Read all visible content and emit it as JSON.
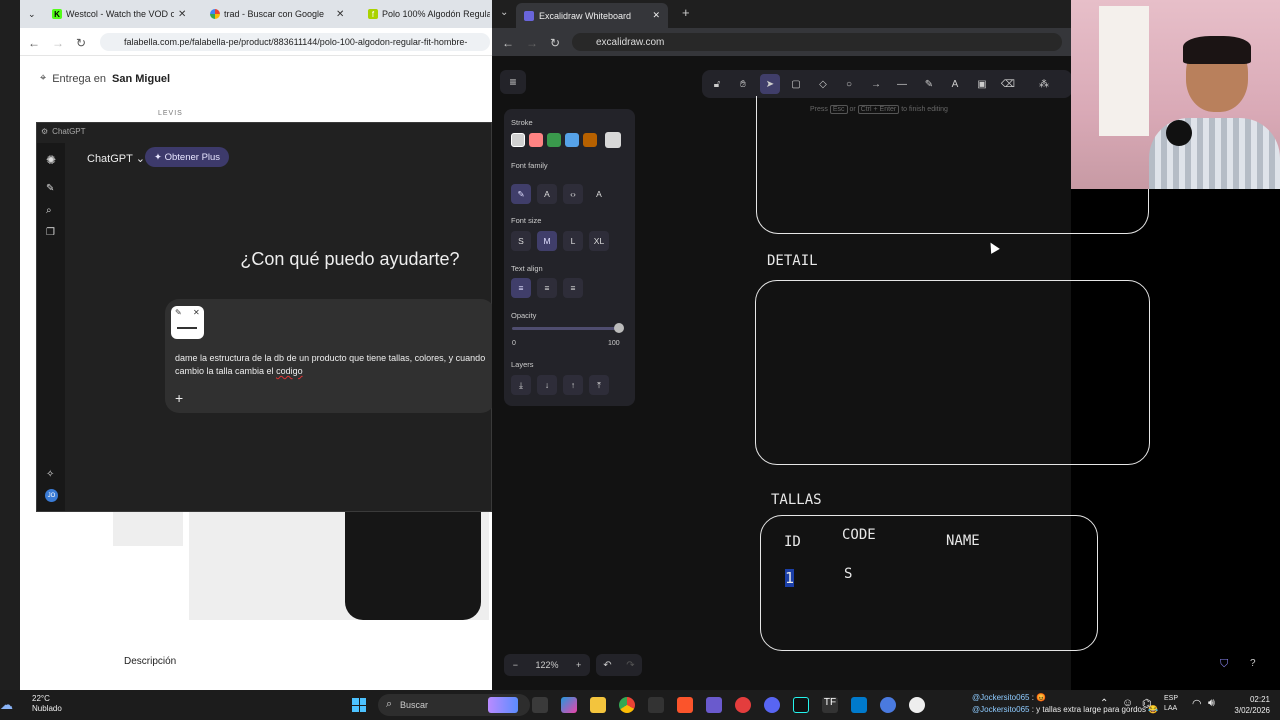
{
  "left_browser": {
    "tabs": [
      {
        "title": "Westcol - Watch the VOD on K",
        "icon": "kick-icon"
      },
      {
        "title": "trad - Buscar con Google",
        "icon": "google-icon"
      },
      {
        "title": "Polo 100% Algodón Regular Fi",
        "icon": "falabella-icon"
      }
    ],
    "url": "falabella.com.pe/falabella-pe/product/883611144/polo-100-algodon-regular-fit-hombre-",
    "delivery_prefix": "Entrega en",
    "delivery_location": "San Miguel",
    "brand": "LEVIS",
    "description_label": "Descripción"
  },
  "chatgpt": {
    "window_title": "ChatGPT",
    "model": "ChatGPT",
    "upgrade_label": "✦ Obtener Plus",
    "heading": "¿Con qué puedo ayudarte?",
    "message_part1": "dame la estructura de la db de un producto que tiene tallas, colores, y cuando cambio la talla cambia el ",
    "message_part2": "codigo",
    "avatar_initials": "JO"
  },
  "right_browser": {
    "tab_title": "Excalidraw Whiteboard",
    "url": "excalidraw.com"
  },
  "excalidraw": {
    "hint": "Press",
    "hint_key1": "Esc",
    "hint_or": "or",
    "hint_key2": "Ctrl + Enter",
    "hint_suffix": "to finish editing",
    "panel": {
      "stroke": "Stroke",
      "font_family": "Font family",
      "font_size": "Font size",
      "sizes": [
        "S",
        "M",
        "L",
        "XL"
      ],
      "text_align": "Text align",
      "opacity": "Opacity",
      "opacity_min": "0",
      "opacity_max": "100",
      "layers": "Layers",
      "opacity_value_percent": 100
    },
    "stroke_colors": [
      "#d0d0d0",
      "#ff8383",
      "#3a994c",
      "#56a2e8",
      "#b76100"
    ],
    "zoom": "122%",
    "canvas": {
      "label_detail": "DETAIL",
      "label_tallas": "TALLAS",
      "col_id": "ID",
      "col_code": "CODE",
      "col_name": "NAME",
      "val_id": "1",
      "val_code": "S"
    }
  },
  "taskbar": {
    "temperature": "22°C",
    "weather": "Nublado",
    "search": "Buscar",
    "chat_user1": "@Jockersito065",
    "chat_msg1": ": 😡",
    "chat_user2": "@Jockersito065",
    "chat_msg2": ": y tallas extra large para gordos 😂",
    "lang1": "ESP",
    "lang2": "LAA",
    "time": "02:21",
    "date": "3/02/2026"
  }
}
